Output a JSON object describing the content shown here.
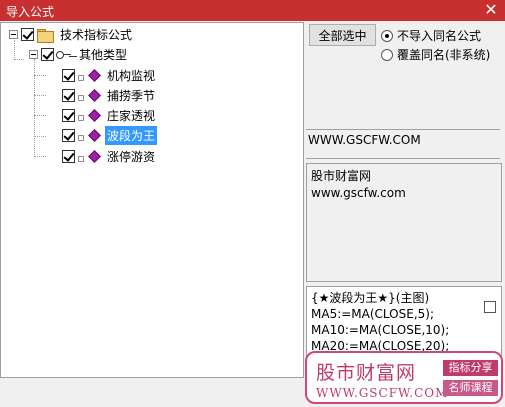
{
  "window": {
    "title": "导入公式",
    "close_glyph": "✕"
  },
  "tree": {
    "root": {
      "label": "技术指标公式",
      "checked": true
    },
    "group": {
      "label": "其他类型",
      "checked": true
    },
    "items": [
      {
        "label": "机构监视",
        "checked": true,
        "selected": false
      },
      {
        "label": "捕捞季节",
        "checked": true,
        "selected": false
      },
      {
        "label": "庄家透视",
        "checked": true,
        "selected": false
      },
      {
        "label": "波段为王",
        "checked": true,
        "selected": true
      },
      {
        "label": "涨停游资",
        "checked": true,
        "selected": false
      }
    ]
  },
  "controls": {
    "select_all_label": "全部选中",
    "radio_skip_label": "不导入同名公式",
    "radio_overwrite_label": "覆盖同名(非系统)",
    "selected_option": "skip"
  },
  "info": {
    "url_text": "WWW.GSCFW.COM",
    "desc_line1": "股市财富网",
    "desc_line2": "www.gscfw.com"
  },
  "code": {
    "lines": [
      "{★波段为王★}(主图)",
      "MA5:=MA(CLOSE,5);",
      "MA10:=MA(CLOSE,10);",
      "MA20:=MA(CLOSE,20);"
    ]
  },
  "watermark": {
    "title": "股市财富网",
    "url": "WWW.GSCFW.COM",
    "tag1": "指标分享",
    "tag2": "名师课程"
  },
  "colors": {
    "titlebar": "#c8302f",
    "selection": "#3399ff",
    "watermark": "#c03a6e"
  }
}
